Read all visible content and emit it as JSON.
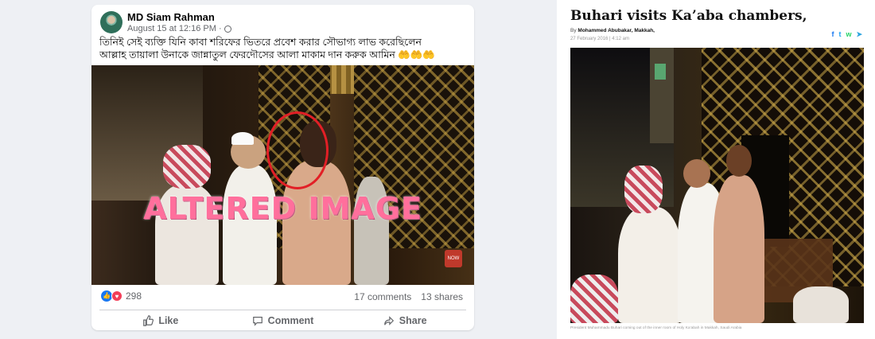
{
  "post": {
    "author": "MD Siam Rahman",
    "timestamp": "August 15 at 12:16 PM · ",
    "text_line_1": "তিনিই সেই  ব্যক্তি যিনি কাবা শরিফের ভিতরে প্রবেশ করার সৌভাগ্য লাভ করেছিলেন",
    "text_line_2": "আল্লাহ তায়ালা উনাকে জান্নাতুল ফেরদৌসের আলা মাকাম দান করুক আমিন",
    "emojis": "🤲🤲🤲",
    "overlay_label": "ALTERED IMAGE",
    "channel_badge": "NOW",
    "reaction_count": "298",
    "comments": "17 comments",
    "shares": "13 shares",
    "actions": {
      "like": "Like",
      "comment": "Comment",
      "share": "Share"
    }
  },
  "article": {
    "title": "Buhari visits Ka’aba chambers,",
    "by_prefix": "By ",
    "byline": "Mohammed Abubakar, Makkah,",
    "date": "27 February 2016  |  4:12 am",
    "caption": "President Muhammadu Buhari coming out of the inner room of Holy Ka’abah in Makkah, Saudi Arabia",
    "share_icons": [
      {
        "name": "facebook-icon",
        "glyph": "f",
        "color": "#1877f2"
      },
      {
        "name": "twitter-icon",
        "glyph": "t",
        "color": "#1da1f2"
      },
      {
        "name": "whatsapp-icon",
        "glyph": "w",
        "color": "#25d366"
      },
      {
        "name": "telegram-icon",
        "glyph": "➤",
        "color": "#2aa3df"
      }
    ]
  },
  "colors": {
    "facebook_blue": "#1877f2",
    "overlay_pink": "#ff6f9c",
    "circle_red": "#e21f26"
  }
}
